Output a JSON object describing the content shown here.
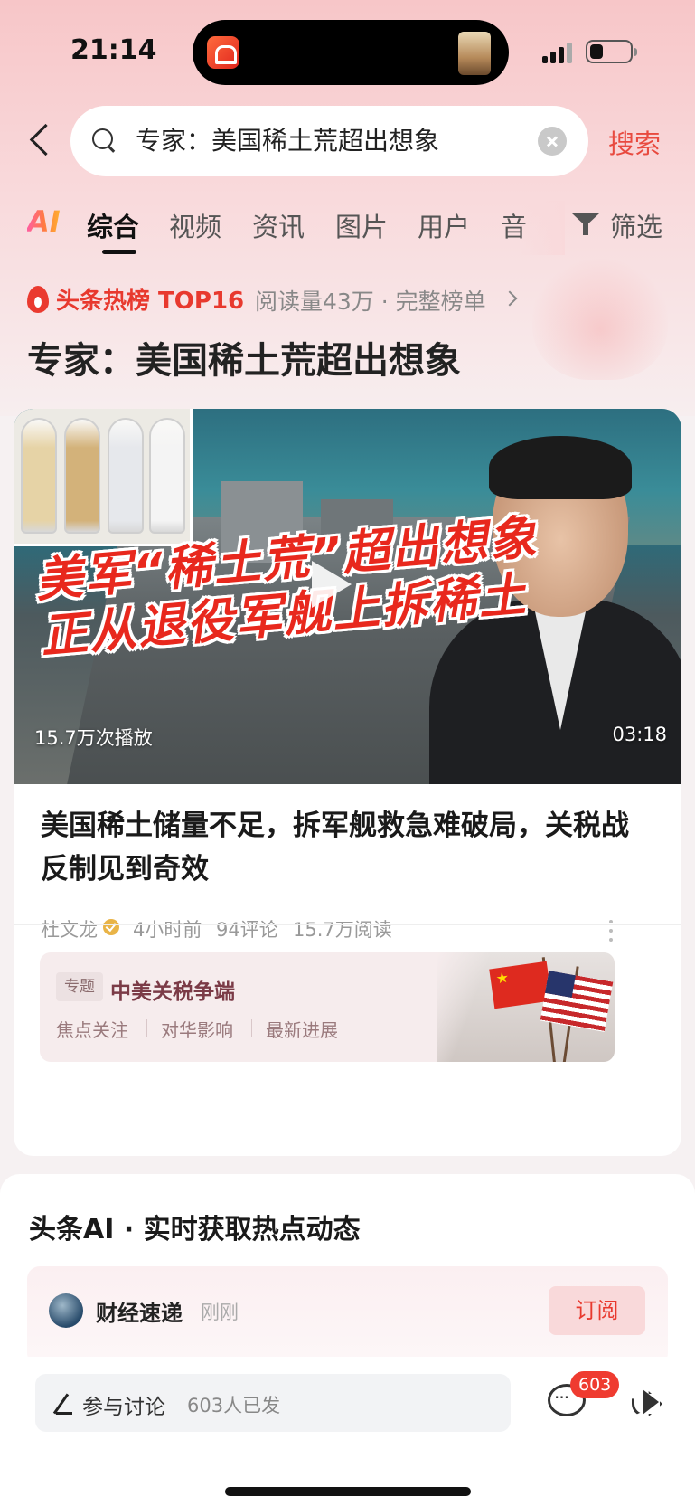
{
  "status_bar": {
    "time": "21:14"
  },
  "search": {
    "query": "专家：美国稀土荒超出想象",
    "button_label": "搜索"
  },
  "tabs": {
    "ai": "AI",
    "items": [
      "综合",
      "视频",
      "资讯",
      "图片",
      "用户",
      "音"
    ],
    "active": "综合",
    "filter": "筛选"
  },
  "hot": {
    "label": "头条热榜 TOP16",
    "meta": "阅读量43万 · 完整榜单"
  },
  "page_title": "专家：美国稀土荒超出想象",
  "video": {
    "banner_line1": "美军“稀土荒”超出想象",
    "banner_line2": "正从退役军舰上拆稀土",
    "play_count": "15.7万次播放",
    "duration": "03:18"
  },
  "article": {
    "headline": "美国稀土储量不足，拆军舰救急难破局，关税战反制见到奇效",
    "author": "杜文龙",
    "time": "4小时前",
    "comments": "94评论",
    "reads": "15.7万阅读"
  },
  "topic": {
    "tag": "专题",
    "title": "中美关税争端",
    "links": [
      "焦点关注",
      "对华影响",
      "最新进展"
    ]
  },
  "ai_section": {
    "title": "头条AI · 实时获取热点动态",
    "feed": {
      "name": "财经速递",
      "time": "刚刚",
      "subscribe": "订阅"
    }
  },
  "bottom": {
    "discuss_label": "参与讨论",
    "discuss_count": "603人已发",
    "comment_badge": "603"
  },
  "colors": {
    "accent": "#e8392e",
    "hot_red": "#ea3a2f"
  }
}
